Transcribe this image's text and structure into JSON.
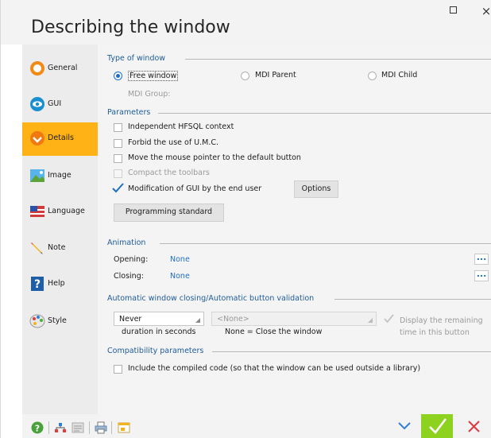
{
  "window": {
    "title": "Describing the window",
    "buttons": {
      "maximize": "maximize",
      "close": "×"
    }
  },
  "sidebar": {
    "items": [
      {
        "label": "General",
        "icon": "general-icon",
        "active": false
      },
      {
        "label": "GUI",
        "icon": "eye-icon",
        "active": false
      },
      {
        "label": "Details",
        "icon": "details-icon",
        "active": true
      },
      {
        "label": "Image",
        "icon": "image-icon",
        "active": false
      },
      {
        "label": "Language",
        "icon": "language-icon",
        "active": false
      },
      {
        "label": "Note",
        "icon": "pencil-icon",
        "active": false
      },
      {
        "label": "Help",
        "icon": "help-icon",
        "active": false
      },
      {
        "label": "Style",
        "icon": "palette-icon",
        "active": false
      }
    ],
    "active_color": "#ffb215"
  },
  "type_of_window": {
    "heading": "Type of window",
    "options": [
      "Free window",
      "MDI Parent",
      "MDI Child"
    ],
    "selected": "Free window",
    "mdi_group_label": "MDI Group:"
  },
  "parameters": {
    "heading": "Parameters",
    "items": [
      {
        "label": "Independent HFSQL context",
        "checked": false,
        "enabled": true
      },
      {
        "label": "Forbid the use of U.M.C.",
        "checked": false,
        "enabled": true
      },
      {
        "label": "Move the mouse pointer to the default button",
        "checked": false,
        "enabled": true
      },
      {
        "label": "Compact the toolbars",
        "checked": false,
        "enabled": false
      },
      {
        "label": "Modification of GUI by the end user",
        "checked": true,
        "enabled": true
      }
    ],
    "options_button": "Options",
    "programming_standard_button": "Programming standard"
  },
  "animation": {
    "heading": "Animation",
    "opening_label": "Opening:",
    "opening_value": "None",
    "closing_label": "Closing:",
    "closing_value": "None",
    "more_button": "..."
  },
  "auto_close": {
    "heading": "Automatic window closing/Automatic button validation",
    "duration_value": "Never",
    "duration_caption": "duration in seconds",
    "target_placeholder": "<None>",
    "target_caption": "None = Close the window",
    "remaining_line1": "Display the remaining",
    "remaining_line2": "time in this button"
  },
  "compatibility": {
    "heading": "Compatibility parameters",
    "include_compiled": "Include the compiled code (so that the window can be used outside a library)"
  },
  "colors": {
    "accent": "#1e6fc4",
    "ok": "#8cd21e",
    "cancel": "#e0383e"
  }
}
